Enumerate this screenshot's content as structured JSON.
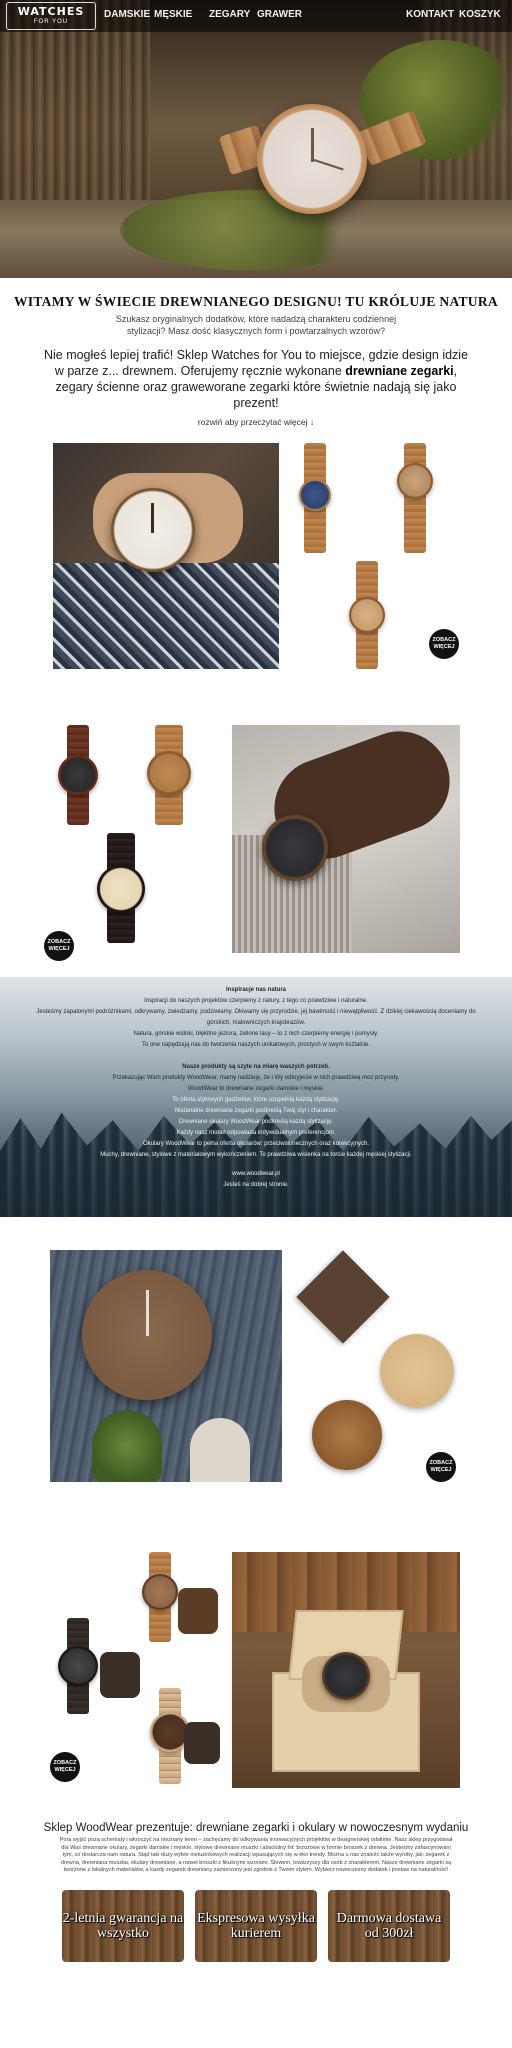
{
  "nav": {
    "logo_line1": "WATCHES",
    "logo_line2": "FOR YOU",
    "items": [
      "DAMSKIE",
      "MĘSKIE",
      "ZEGARY",
      "GRAWER"
    ],
    "right_items": [
      "KONTAKT",
      "KOSZYK"
    ]
  },
  "intro": {
    "title": "WITAMY W ŚWIECIE DREWNIANEGO DESIGNU! TU KRÓLUJE NATURA",
    "subtitle": "Szukasz oryginalnych dodatków, które nadadzą charakteru codziennej stylizacji? Masz dość klasycznych form i powtarzalnych wzorów?",
    "lead_part1": "Nie mogłeś lepiej trafić! Sklep Watches for You to miejsce, gdzie design idzie w parze z... drewnem. Oferujemy ręcznie wykonane ",
    "lead_bold": "drewniane zegarki",
    "lead_part2": ", zegary ścienne oraz graweworane zegarki które świetnie nadają się jako prezent!",
    "more": "rozwiń aby przeczytać więcej ↓"
  },
  "badges": {
    "more_label": "ZOBACZ WIĘCEJ"
  },
  "banner": {
    "heading1": "Inspiracje nas natura",
    "lines1": [
      "Inspiracji do naszych projektów czerpiemy z natury, z tego co prawdziwe i naturalne.",
      "Jesteśmy zapalonymi podróżnikami, odkrywamy, zwiedzamy, podziwiamy. Okiwamy się przyrodzie, jej bawimość i niewątpliwość. Z dzikiej ciekawością doceniamy do",
      "górskich, malowniczych krajobrazów.",
      "Natura, górskie widoki, błękitne jeziora, zielone lasy – to z nich czerpiemy energię i pomysły.",
      "To one napędzają nas do tworzenia naszych unikatowych, prostych w swym kształcie."
    ],
    "heading2": "Nasze produkty są szyte na miarę waszych potrzeb.",
    "lines2": [
      "Przekazując Wam produkty WoodWear, mamy nadzieję, że i Wy odkryjecie w nich prawdziwą moc przyrody.",
      "WoodWear to drewniane zegarki damskie i męskie.",
      "To oferta stylowych gadżetów, które uzupełnią każdą stylizację.",
      "Nietanalne drewniane zegarki podkreślą Twój styl i charakter.",
      "Drewniane okulary WoodWear podkreślą każdą stylizację.",
      "Każdy nasz model odpowiada indywidualnym preferencjom.",
      "Okulary WoodWear to pełna oferta okularów: przeciwsłonecznych oraz korekcyjnych.",
      "Muchy, drewniane, stylowe z materiałowym wykończeniem. To prawdziwa wisienka na torcie każdej męskiej stylizacji."
    ],
    "site": "www.woodwear.pl",
    "site_note": "Jesteś na dobrej stronie."
  },
  "footer": {
    "title": "Sklep WoodWear prezentuje: drewniane zegarki i okulary w nowoczesnym wydaniu",
    "text": "Pora wyjść poza schematy i wkroczyć na nieznany teren – zachęcamy do odkrywania innowacyjnych projektów w designerskiej odsłonie. Nasz sklep przygotował dla Was drewniane okulary, zegarki damskie i męskie, stylowe drewniane muszki i absolutny hit: brzozowe w formie broszek z drewna. Jesteśmy zafascynowani tym, co dostarcza nam natura. Stąd taki duży wybór nietuzinkowych realizacji wpasujących się w eko trendy. Można u nas znaleźć także wyroby, jak: zegarek z drewna, drewniana muszka, okulary drewniane, a nawet broszki z fikuśnymi wzorami. Słowem, towarzyszy dla osób z charakterem. Nasze drewniane zegarki są tworzone z lokalnych materiałów, a każdy zegarek drewniany zamierzony jest zgodnie z Twoim stylem. Wybierz nowoczesny dodatek i postaw na naturalność!"
  },
  "features": [
    {
      "text": "2-letnia gwarancja na wszystko"
    },
    {
      "text": "Ekspresowa wysyłka kurierem"
    },
    {
      "text": "Darmowa dostawa od 300zł"
    }
  ],
  "colors": {
    "nav_bg": "#000000",
    "badge_bg": "#111111",
    "banner_bottom": "#2c3a44"
  }
}
